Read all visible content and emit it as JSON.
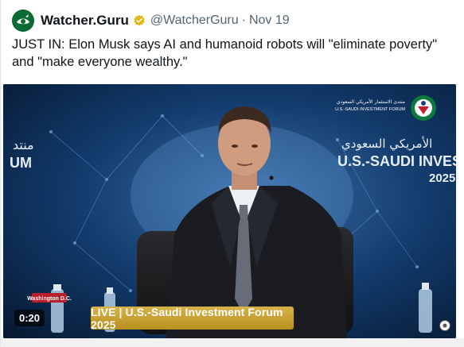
{
  "post": {
    "display_name": "Watcher.Guru",
    "handle": "@WatcherGuru",
    "separator": "·",
    "date": "Nov 19",
    "text": "JUST IN: Elon Musk says AI and humanoid robots will \"eliminate poverty\" and \"make everyone wealthy.\""
  },
  "video": {
    "timestamp": "0:20",
    "live_banner": "LIVE | U.S.-Saudi Investment Forum 2025",
    "backdrop_arabic_left": "منتد",
    "backdrop_um": "UM",
    "backdrop_arabic_right": "الأمريكي السعودي",
    "backdrop_event": "U.S.-SAUDI INVEST",
    "backdrop_year": "2025",
    "logo_caption_arabic": "منتدى الاستثمار الأمريكي السعودي",
    "logo_caption": "U.S.-SAUDI INVESTMENT FORUM",
    "podium_badge": "Washington D.C."
  },
  "colors": {
    "verified_gold": "#e2b719",
    "live_gold": "#c9a232",
    "avatar_green": "#0b6b34"
  },
  "icons": [
    "watcher-guru-avatar-icon",
    "verified-badge-icon",
    "settings-gear-icon"
  ]
}
